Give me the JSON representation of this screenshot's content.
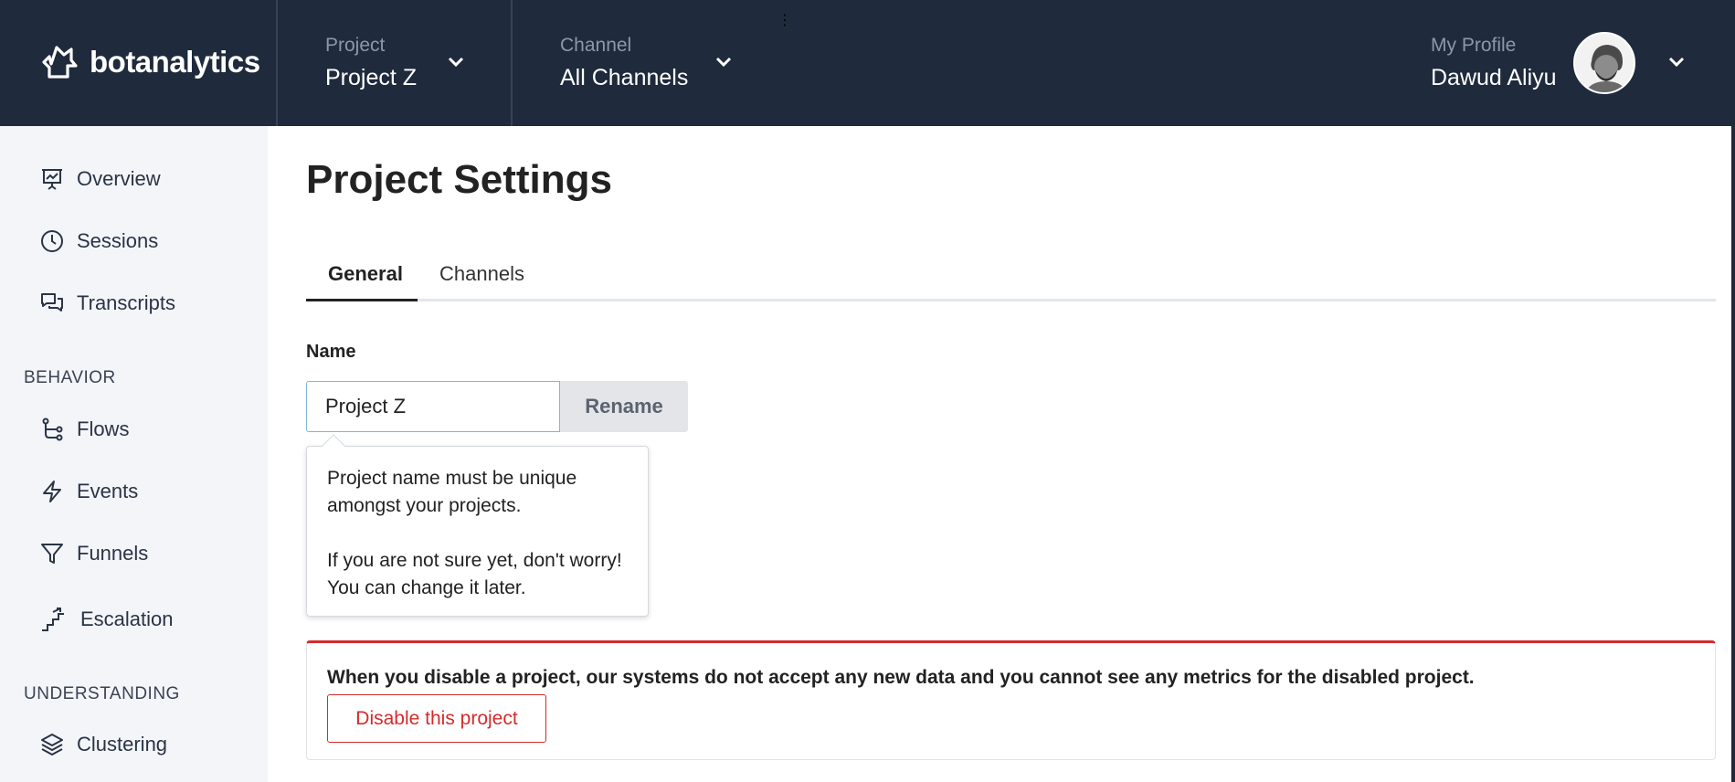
{
  "header": {
    "brand": "botanalytics",
    "project": {
      "caption": "Project",
      "value": "Project Z"
    },
    "channel": {
      "caption": "Channel",
      "value": "All Channels"
    },
    "profile": {
      "caption": "My Profile",
      "value": "Dawud Aliyu"
    }
  },
  "sidebar": {
    "items": [
      {
        "label": "Overview",
        "icon": "presentation-chart-icon"
      },
      {
        "label": "Sessions",
        "icon": "clock-icon"
      },
      {
        "label": "Transcripts",
        "icon": "chat-bubbles-icon"
      }
    ],
    "behavior_label": "BEHAVIOR",
    "behavior_items": [
      {
        "label": "Flows",
        "icon": "flow-icon"
      },
      {
        "label": "Events",
        "icon": "lightning-icon"
      },
      {
        "label": "Funnels",
        "icon": "funnel-icon"
      },
      {
        "label": "Escalation",
        "icon": "stairs-icon"
      }
    ],
    "understanding_label": "UNDERSTANDING",
    "understanding_items": [
      {
        "label": "Clustering",
        "icon": "layers-icon"
      }
    ]
  },
  "main": {
    "title": "Project Settings",
    "tabs": [
      {
        "label": "General",
        "active": true
      },
      {
        "label": "Channels",
        "active": false
      }
    ],
    "name_label": "Name",
    "name_value": "Project Z",
    "rename_label": "Rename",
    "tooltip": {
      "line1": "Project name must be unique amongst your projects.",
      "line2": "If you are not sure yet, don't worry! You can change it later."
    },
    "danger": {
      "message": "When you disable a project, our systems do not accept any new data and you cannot see any metrics for the disabled project.",
      "button_label": "Disable this project"
    }
  },
  "colors": {
    "header_bg": "#1f2a3c",
    "sidebar_bg": "#f3f5f8",
    "danger": "#d52b2b",
    "input_border": "#7fb7d4"
  }
}
